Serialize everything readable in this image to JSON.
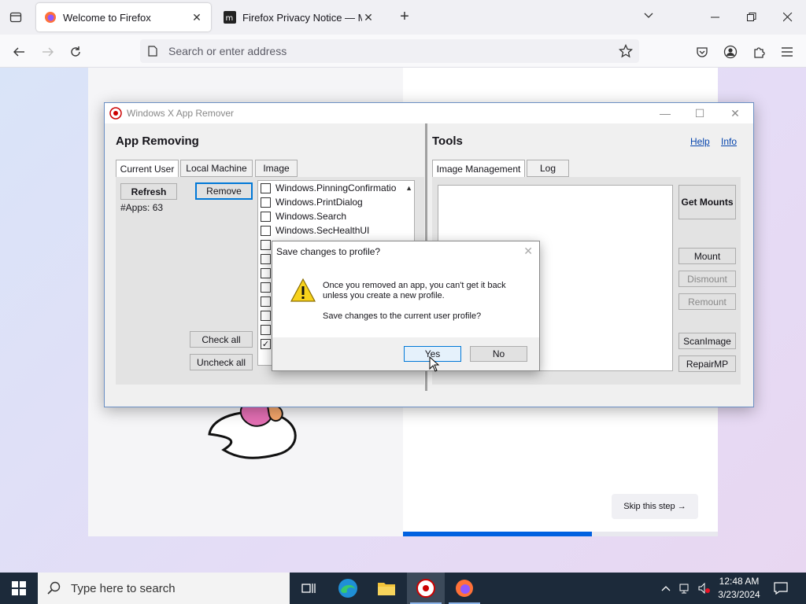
{
  "browser": {
    "tabs": [
      {
        "title": "Welcome to Firefox",
        "active": true
      },
      {
        "title": "Firefox Privacy Notice — Mozill",
        "active": false
      }
    ],
    "urlbar_placeholder": "Search or enter address"
  },
  "page": {
    "skip_label": "Skip this step →",
    "progress_fraction": 0.6
  },
  "app": {
    "title": "Windows X App Remover",
    "left": {
      "heading": "App Removing",
      "tabs": [
        "Current User",
        "Local Machine",
        "Image"
      ],
      "refresh": "Refresh",
      "remove": "Remove",
      "app_count": "#Apps: 63",
      "check_all": "Check all",
      "uncheck_all": "Uncheck all",
      "apps": [
        {
          "name": "Windows.PinningConfirmatio",
          "checked": false
        },
        {
          "name": "Windows.PrintDialog",
          "checked": false
        },
        {
          "name": "Windows.Search",
          "checked": false
        },
        {
          "name": "Windows.SecHealthUI",
          "checked": false
        }
      ]
    },
    "right": {
      "heading": "Tools",
      "help": "Help",
      "info": "Info",
      "tabs": [
        "Image Management",
        "Log"
      ],
      "get_mounts": "Get Mounts",
      "mount": "Mount",
      "dismount": "Dismount",
      "remount": "Remount",
      "scan_image": "ScanImage",
      "repair_mp": "RepairMP"
    }
  },
  "dialog": {
    "title": "Save changes to profile?",
    "line1": "Once you removed an app, you can't get it back",
    "line2": "unless you create a new profile.",
    "line3": "Save changes to the current user profile?",
    "yes": "Yes",
    "no": "No"
  },
  "taskbar": {
    "search_placeholder": "Type here to search",
    "time": "12:48 AM",
    "date": "3/23/2024"
  }
}
